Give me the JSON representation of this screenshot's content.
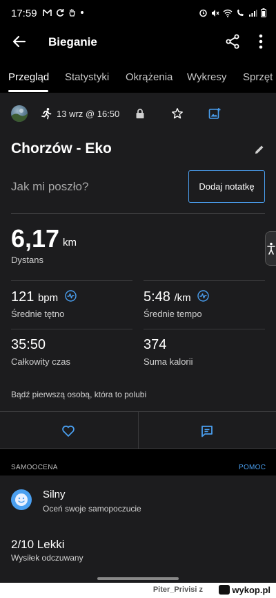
{
  "status_bar": {
    "time": "17:59"
  },
  "app_bar": {
    "title": "Bieganie"
  },
  "tabs": [
    {
      "label": "Przegląd",
      "active": true
    },
    {
      "label": "Statystyki"
    },
    {
      "label": "Okrążenia"
    },
    {
      "label": "Wykresy"
    },
    {
      "label": "Sprzęt"
    }
  ],
  "activity": {
    "date": "13 wrz @ 16:50",
    "title": "Chorzów - Eko",
    "feel_question": "Jak mi poszło?",
    "add_note_label": "Dodaj notatkę"
  },
  "stats": {
    "distance": {
      "value": "6,17",
      "unit": "km",
      "label": "Dystans"
    },
    "avg_hr": {
      "value": "121",
      "unit": "bpm",
      "label": "Średnie tętno"
    },
    "avg_pace": {
      "value": "5:48",
      "unit": "/km",
      "label": "Średnie tempo"
    },
    "total_time": {
      "value": "35:50",
      "label": "Całkowity czas"
    },
    "calories": {
      "value": "374",
      "label": "Suma kalorii"
    }
  },
  "social": {
    "likes_text": "Bądź pierwszą osobą, która to polubi"
  },
  "self_assessment": {
    "section_title": "SAMOOCENA",
    "help_label": "POMOC",
    "feeling": {
      "title": "Silny",
      "subtitle": "Oceń swoje samopoczucie"
    },
    "effort": {
      "title": "2/10 Lekki",
      "subtitle": "Wysiłek odczuwany"
    }
  },
  "footer": {
    "user_text": "Piter_Privisi z",
    "logo_text": "wykop.pl"
  },
  "colors": {
    "accent": "#4a9ff0",
    "background": "#1c1c1e",
    "topbar": "#000000"
  },
  "icons": [
    "back-arrow-icon",
    "share-icon",
    "more-vert-icon",
    "run-icon",
    "lock-icon",
    "star-icon",
    "add-photo-icon",
    "edit-pencil-icon",
    "heart-rate-icon",
    "heart-icon",
    "comment-icon",
    "smiley-icon",
    "accessibility-icon"
  ]
}
